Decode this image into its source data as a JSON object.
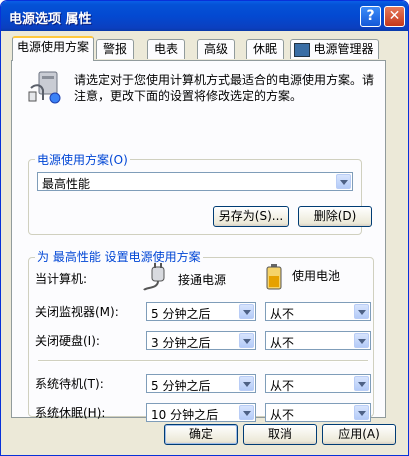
{
  "window": {
    "title": "电源选项 属性",
    "help": "?",
    "close": "✕"
  },
  "tabs": [
    "电源使用方案",
    "警报",
    "电表",
    "高级",
    "休眠",
    "电源管理器"
  ],
  "intro": {
    "line1": "请选定对于您使用计算机方式最适合的电源使用方案。请",
    "line2": "注意，更改下面的设置将修改选定的方案。"
  },
  "scheme_group": {
    "title": "电源使用方案(O)",
    "selected": "最高性能",
    "save_as_label": "另存为(S)...",
    "delete_label": "删除(D)"
  },
  "settings_group": {
    "title": "为 最高性能 设置电源使用方案",
    "computer_label": "当计算机:",
    "plugged_in_label": "接通电源",
    "on_battery_label": "使用电池",
    "rows": [
      {
        "label": "关闭监视器(M):",
        "plugged": "5 分钟之后",
        "battery": "从不"
      },
      {
        "label": "关闭硬盘(I):",
        "plugged": "3 分钟之后",
        "battery": "从不"
      },
      {
        "label": "系统待机(T):",
        "plugged": "5 分钟之后",
        "battery": "从不"
      },
      {
        "label": "系统休眠(H):",
        "plugged": "10 分钟之后",
        "battery": "从不"
      }
    ]
  },
  "footer": {
    "ok_label": "确定",
    "cancel_label": "取消",
    "apply_label": "应用(A)"
  },
  "colors": {
    "title_bar": "#0452d6",
    "group_title": "#0046d5",
    "annotation": "#c8102e",
    "dialog_bg": "#ece9d8"
  }
}
